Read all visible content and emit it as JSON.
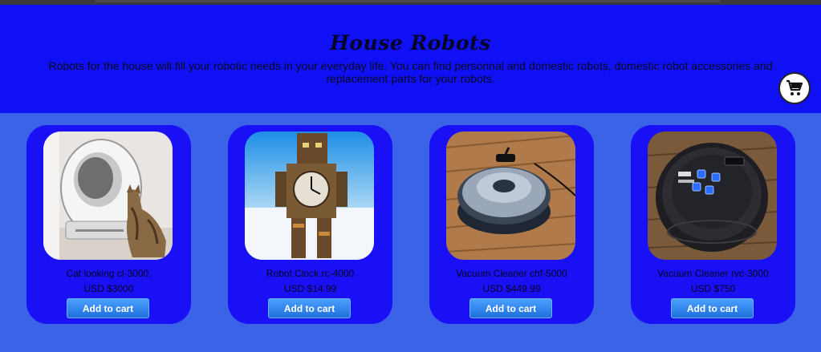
{
  "header": {
    "title": "House Robots",
    "description": "Robots for the house will fill your robotic needs in your everyday life. You can find personnal and domestic robots, domestic robot accessories and replacement parts for your robots."
  },
  "cart": {
    "icon": "shopping-cart-icon"
  },
  "products": [
    {
      "name": "Cat looking cl-3000.",
      "price": "USD $3000",
      "button": "Add to cart",
      "image": "cat-litter-robot-image"
    },
    {
      "name": "Robot Clock rc-4000",
      "price": "USD $14.99",
      "button": "Add to cart",
      "image": "robot-clock-image"
    },
    {
      "name": "Vacuum Cleaner chf-5000",
      "price": "USD $449.99",
      "button": "Add to cart",
      "image": "vacuum-robot-image"
    },
    {
      "name": "Vacuum Cleaner rvc-3000",
      "price": "USD $750",
      "button": "Add to cart",
      "image": "vacuum-robot-dark-image"
    }
  ],
  "colors": {
    "page_background": "#3b63e8",
    "header_background": "#1010f5",
    "card_background": "#1a10f5",
    "button_gradient_top": "#4aa0ff",
    "button_gradient_bottom": "#1e6fdd"
  }
}
